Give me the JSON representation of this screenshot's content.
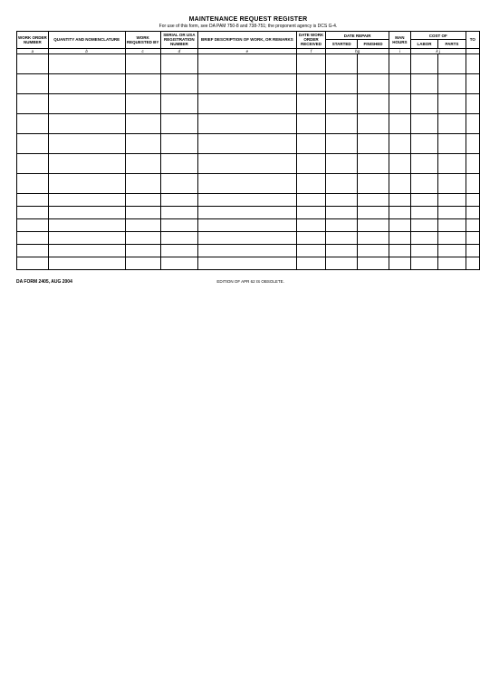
{
  "title": "MAINTENANCE REQUEST REGISTER",
  "subtitle": "For use of this form, see DA PAM 750-8 and 738-751; the proponent agency is DCS G-4.",
  "header": {
    "work_order_number": "WORK ORDER NUMBER",
    "quantity_nomenclature": "QUANTITY AND NOMENCLATURE",
    "work_requested_by": "WORK REQUESTED BY",
    "serial_registration": "SERIAL OR USA REGISTRATION NUMBER",
    "brief_description": "BRIEF DESCRIPTION OF WORK, OR REMARKS",
    "date_work_order_received": "DATE WORK ORDER RECEIVED",
    "date_repair": "DATE REPAIR",
    "started": "STARTED",
    "finished": "FINISHED",
    "man_hours": "MAN HOURS",
    "cost_of": "COST OF",
    "labor": "LABOR",
    "parts": "PARTS",
    "to": "TO"
  },
  "sub": {
    "a": "a",
    "b": "b",
    "c": "c",
    "d": "d",
    "e": "e",
    "f": "f",
    "hg": "hg",
    "i": "i",
    "kj": "k j"
  },
  "footer": {
    "form_id": "DA FORM 2405, AUG 2004",
    "obsolete": "EDITION OF APR 62 IS OBSOLETE."
  },
  "rows": 13
}
